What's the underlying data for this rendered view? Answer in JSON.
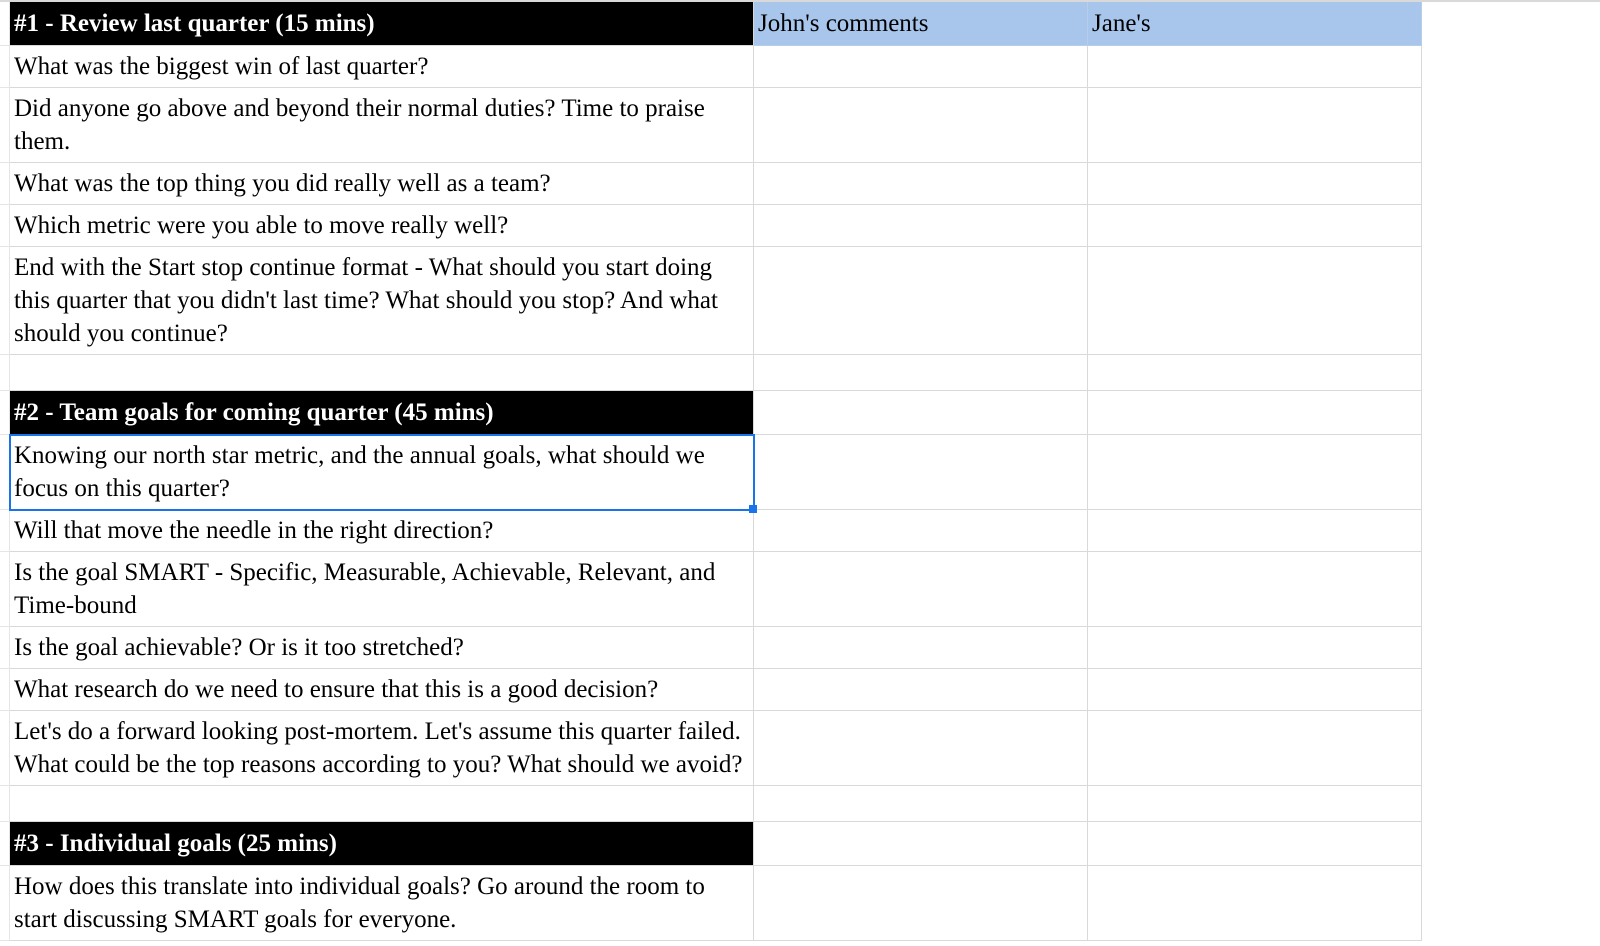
{
  "columns": {
    "comments1": "John's comments",
    "comments2": "Jane's"
  },
  "sections": [
    {
      "header": "#1 - Review last quarter (15 mins)",
      "items": [
        "What was the biggest win of last quarter?",
        "Did anyone go above and beyond their normal duties? Time to praise them.",
        "What was the top thing you did really well as a team?",
        "Which metric were you able to move really well?",
        "End with the Start stop continue format - What should you start doing this quarter that you didn't last time? What should you stop? And what should you continue?"
      ]
    },
    {
      "header": "#2 - Team goals for coming quarter (45 mins)",
      "items": [
        "Knowing our north star metric, and the annual goals, what should we focus on this quarter?",
        "Will that move the needle in the right direction?",
        "Is the goal SMART - Specific, Measurable, Achievable, Relevant, and Time-bound",
        "Is the goal achievable? Or is it too stretched?",
        "What research do we need to ensure that this is a good decision?",
        "Let's do a forward looking post-mortem. Let's assume this quarter failed. What could be the top reasons according to you? What should we avoid?"
      ]
    },
    {
      "header": "#3 - Individual goals (25 mins)",
      "items": [
        "How does this translate into individual goals? Go around the room to start discussing SMART goals for everyone."
      ]
    }
  ],
  "selected": {
    "section": 1,
    "item": 0
  }
}
